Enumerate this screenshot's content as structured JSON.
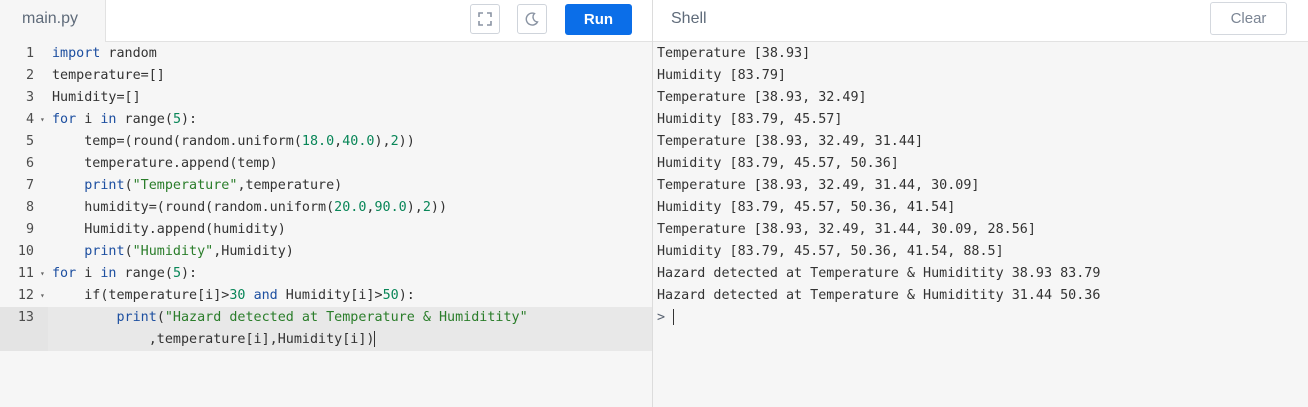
{
  "editor": {
    "file_tab": "main.py",
    "run_label": "Run",
    "lines": [
      {
        "n": "1",
        "fold": false,
        "tokens": [
          {
            "t": "import",
            "c": "kw"
          },
          {
            "t": " random",
            "c": "pl"
          }
        ]
      },
      {
        "n": "2",
        "fold": false,
        "tokens": [
          {
            "t": "temperature=[]",
            "c": "pl"
          }
        ]
      },
      {
        "n": "3",
        "fold": false,
        "tokens": [
          {
            "t": "Humidity=[]",
            "c": "pl"
          }
        ]
      },
      {
        "n": "4",
        "fold": true,
        "tokens": [
          {
            "t": "for",
            "c": "kw"
          },
          {
            "t": " i ",
            "c": "pl"
          },
          {
            "t": "in",
            "c": "kw"
          },
          {
            "t": " range(",
            "c": "pl"
          },
          {
            "t": "5",
            "c": "num"
          },
          {
            "t": "):",
            "c": "pl"
          }
        ]
      },
      {
        "n": "5",
        "fold": false,
        "tokens": [
          {
            "t": "    temp=(round(random.uniform(",
            "c": "pl"
          },
          {
            "t": "18.0",
            "c": "num"
          },
          {
            "t": ",",
            "c": "pl"
          },
          {
            "t": "40.0",
            "c": "num"
          },
          {
            "t": "),",
            "c": "pl"
          },
          {
            "t": "2",
            "c": "num"
          },
          {
            "t": "))",
            "c": "pl"
          }
        ]
      },
      {
        "n": "6",
        "fold": false,
        "tokens": [
          {
            "t": "    temperature.append(temp)",
            "c": "pl"
          }
        ]
      },
      {
        "n": "7",
        "fold": false,
        "tokens": [
          {
            "t": "    ",
            "c": "pl"
          },
          {
            "t": "print",
            "c": "fn"
          },
          {
            "t": "(",
            "c": "pl"
          },
          {
            "t": "\"Temperature\"",
            "c": "str2"
          },
          {
            "t": ",temperature)",
            "c": "pl"
          }
        ]
      },
      {
        "n": "8",
        "fold": false,
        "tokens": [
          {
            "t": "    humidity=(round(random.uniform(",
            "c": "pl"
          },
          {
            "t": "20.0",
            "c": "num"
          },
          {
            "t": ",",
            "c": "pl"
          },
          {
            "t": "90.0",
            "c": "num"
          },
          {
            "t": "),",
            "c": "pl"
          },
          {
            "t": "2",
            "c": "num"
          },
          {
            "t": "))",
            "c": "pl"
          }
        ]
      },
      {
        "n": "9",
        "fold": false,
        "tokens": [
          {
            "t": "    Humidity.append(humidity)",
            "c": "pl"
          }
        ]
      },
      {
        "n": "10",
        "fold": false,
        "tokens": [
          {
            "t": "    ",
            "c": "pl"
          },
          {
            "t": "print",
            "c": "fn"
          },
          {
            "t": "(",
            "c": "pl"
          },
          {
            "t": "\"Humidity\"",
            "c": "str2"
          },
          {
            "t": ",Humidity)",
            "c": "pl"
          }
        ]
      },
      {
        "n": "11",
        "fold": true,
        "tokens": [
          {
            "t": "for",
            "c": "kw"
          },
          {
            "t": " i ",
            "c": "pl"
          },
          {
            "t": "in",
            "c": "kw"
          },
          {
            "t": " range(",
            "c": "pl"
          },
          {
            "t": "5",
            "c": "num"
          },
          {
            "t": "):",
            "c": "pl"
          }
        ]
      },
      {
        "n": "12",
        "fold": true,
        "tokens": [
          {
            "t": "    if(temperature[i]>",
            "c": "pl"
          },
          {
            "t": "30",
            "c": "num"
          },
          {
            "t": " ",
            "c": "pl"
          },
          {
            "t": "and",
            "c": "kw"
          },
          {
            "t": " Humidity[i]>",
            "c": "pl"
          },
          {
            "t": "50",
            "c": "num"
          },
          {
            "t": "):",
            "c": "pl"
          }
        ]
      },
      {
        "n": "13",
        "fold": false,
        "active": true,
        "tokens": [
          {
            "t": "        ",
            "c": "pl"
          },
          {
            "t": "print",
            "c": "fn"
          },
          {
            "t": "(",
            "c": "pl"
          },
          {
            "t": "\"Hazard detected at Temperature & Humiditity\"",
            "c": "str2"
          }
        ]
      },
      {
        "n": "",
        "fold": false,
        "wrap": true,
        "tokens": [
          {
            "t": "            ,temperature[i],Humidity[i])",
            "c": "pl"
          }
        ]
      }
    ]
  },
  "shell": {
    "title": "Shell",
    "clear_label": "Clear",
    "output": [
      "Temperature [38.93]",
      "Humidity [83.79]",
      "Temperature [38.93, 32.49]",
      "Humidity [83.79, 45.57]",
      "Temperature [38.93, 32.49, 31.44]",
      "Humidity [83.79, 45.57, 50.36]",
      "Temperature [38.93, 32.49, 31.44, 30.09]",
      "Humidity [83.79, 45.57, 50.36, 41.54]",
      "Temperature [38.93, 32.49, 31.44, 30.09, 28.56]",
      "Humidity [83.79, 45.57, 50.36, 41.54, 88.5]",
      "Hazard detected at Temperature & Humiditity 38.93 83.79",
      "Hazard detected at Temperature & Humiditity 31.44 50.36"
    ],
    "prompt": ">"
  },
  "icons": {
    "fullscreen": "fullscreen-icon",
    "theme": "moon-icon"
  },
  "colors": {
    "run_button": "#0b6ee8",
    "keyword": "#1d4fa0",
    "number": "#098658",
    "string": "#2a7d2a"
  }
}
